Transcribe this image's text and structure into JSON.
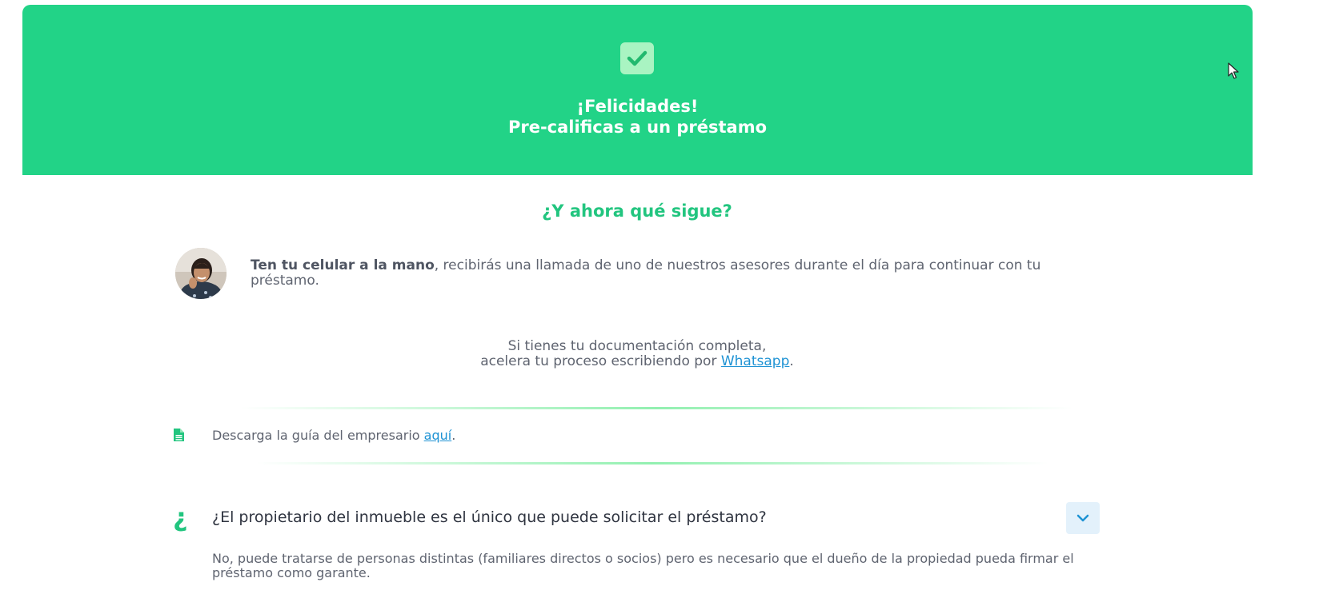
{
  "hero": {
    "line1": "¡Felicidades!",
    "line2": "Pre-calificas a un préstamo",
    "check_icon": "check-icon",
    "background_color": "#22d387"
  },
  "next": {
    "title": "¿Y ahora qué sigue?",
    "call_bold": "Ten tu celular a la mano",
    "call_rest": ", recibirás una llamada de uno de nuestros asesores durante el día para continuar con tu préstamo."
  },
  "whatsapp": {
    "line1": "Si tienes tu documentación completa,",
    "line2_prefix": "acelera tu proceso escribiendo por ",
    "link_label": "Whatsapp",
    "line2_suffix": "."
  },
  "guide": {
    "icon": "document-icon",
    "prefix": "Descarga la guía del empresario ",
    "link_label": "aquí",
    "suffix": "."
  },
  "faq": {
    "icon_glyph": "¿",
    "question": "¿El propietario del inmueble es el único que puede solicitar el préstamo?",
    "answer": "No, puede tratarse de personas distintas (familiares directos o socios) pero es necesario que el dueño de la propiedad pueda firmar el préstamo como garante.",
    "toggle_icon": "chevron-down-icon"
  },
  "colors": {
    "accent": "#22c57f",
    "link": "#1f93d4",
    "toggle_bg": "#e3f1fb"
  }
}
